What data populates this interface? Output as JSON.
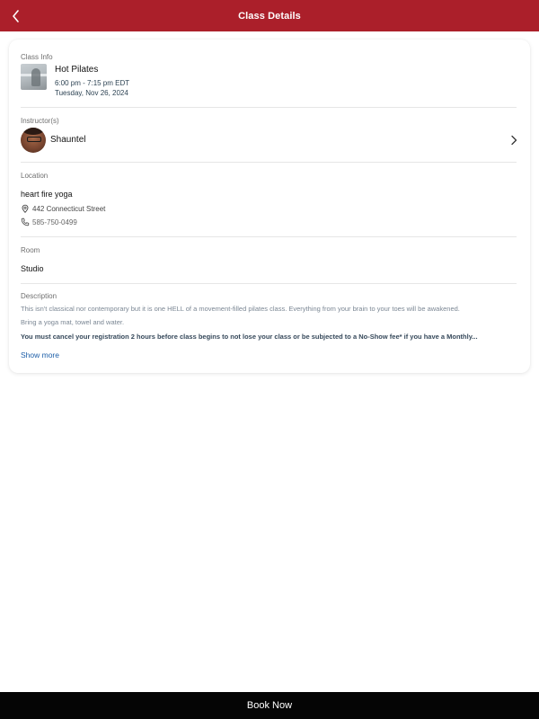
{
  "header": {
    "title": "Class Details",
    "back_icon": "chevron-left-icon"
  },
  "class_info": {
    "label": "Class Info",
    "name": "Hot Pilates",
    "time": "6:00 pm - 7:15 pm EDT",
    "date": "Tuesday, Nov 26, 2024"
  },
  "instructor": {
    "label": "Instructor(s)",
    "name": "Shauntel",
    "chevron_icon": "chevron-right-icon"
  },
  "location": {
    "label": "Location",
    "name": "heart fire yoga",
    "address": "442 Connecticut Street",
    "phone": "585-750-0499",
    "address_icon": "map-pin-icon",
    "phone_icon": "phone-icon"
  },
  "room": {
    "label": "Room",
    "name": "Studio"
  },
  "description": {
    "label": "Description",
    "line1": "This isn't classical nor contemporary but it is one HELL of a movement-filled pilates class. Everything from your brain to your toes will be awakened.",
    "line2": "Bring a yoga mat, towel and water.",
    "line3": "You must cancel your registration 2 hours before class begins to not lose your class or be subjected to a No-Show fee* if you have a Monthly...",
    "show_more": "Show more"
  },
  "footer": {
    "book_label": "Book Now"
  },
  "colors": {
    "header_bg": "#ab1f2a",
    "footer_bg": "#050505",
    "link": "#1c5ea8"
  }
}
